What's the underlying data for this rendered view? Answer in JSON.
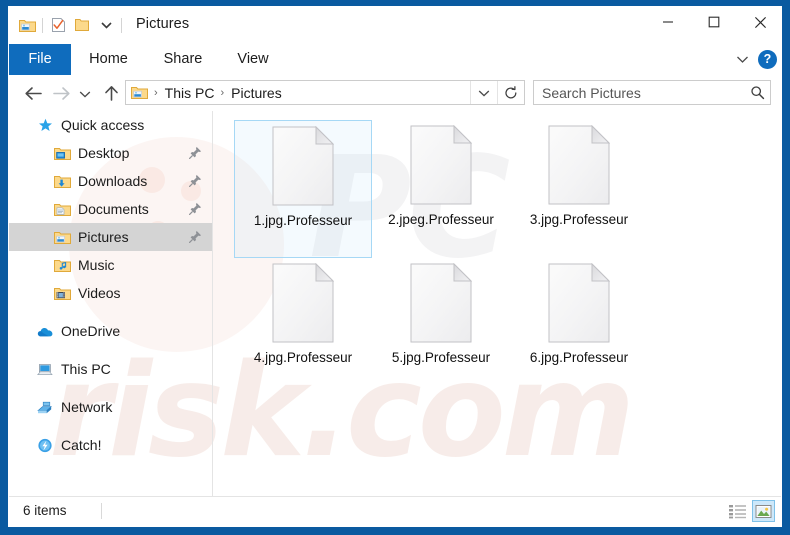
{
  "window": {
    "title": "Pictures",
    "quick_access_toolbar": [
      {
        "name": "properties-icon",
        "label": "Properties"
      },
      {
        "name": "checkbox-icon",
        "label": "Select"
      },
      {
        "name": "new-folder-icon",
        "label": "New folder"
      },
      {
        "name": "chevron-down-icon",
        "label": "Customize Quick Access Toolbar"
      }
    ],
    "caption_buttons": [
      {
        "name": "minimize-button",
        "glyph": "─",
        "label": "Minimize"
      },
      {
        "name": "maximize-button",
        "glyph": "☐",
        "label": "Maximize"
      },
      {
        "name": "close-button",
        "glyph": "✕",
        "label": "Close"
      }
    ]
  },
  "ribbon": {
    "tabs": [
      {
        "label": "File",
        "selected": true
      },
      {
        "label": "Home",
        "selected": false
      },
      {
        "label": "Share",
        "selected": false
      },
      {
        "label": "View",
        "selected": false
      }
    ],
    "collapse_icon": "chevron-down-icon",
    "help_label": "?"
  },
  "navigation": {
    "back_label": "Back",
    "forward_label": "Forward",
    "recent_label": "Recent locations",
    "up_label": "Up",
    "breadcrumb": {
      "icon": "pictures-folder-icon",
      "crumbs": [
        "This PC",
        "Pictures"
      ],
      "separator": "›"
    },
    "dropdown_icon": "chevron-down-icon",
    "refresh_icon": "refresh-icon"
  },
  "search": {
    "placeholder": "Search Pictures",
    "value": "",
    "icon": "search-icon"
  },
  "sidebar": {
    "groups": [
      {
        "items": [
          {
            "label": "Quick access",
            "icon": "star-icon",
            "level": "root",
            "pinned": false,
            "selected": false
          },
          {
            "label": "Desktop",
            "icon": "desktop-folder-icon",
            "level": "child",
            "pinned": true,
            "selected": false
          },
          {
            "label": "Downloads",
            "icon": "downloads-folder-icon",
            "level": "child",
            "pinned": true,
            "selected": false
          },
          {
            "label": "Documents",
            "icon": "documents-folder-icon",
            "level": "child",
            "pinned": true,
            "selected": false
          },
          {
            "label": "Pictures",
            "icon": "pictures-folder-icon",
            "level": "child",
            "pinned": true,
            "selected": true
          },
          {
            "label": "Music",
            "icon": "music-folder-icon",
            "level": "child",
            "pinned": false,
            "selected": false
          },
          {
            "label": "Videos",
            "icon": "videos-folder-icon",
            "level": "child",
            "pinned": false,
            "selected": false
          }
        ]
      },
      {
        "items": [
          {
            "label": "OneDrive",
            "icon": "onedrive-cloud-icon",
            "level": "root",
            "pinned": false,
            "selected": false
          }
        ]
      },
      {
        "items": [
          {
            "label": "This PC",
            "icon": "this-pc-icon",
            "level": "root",
            "pinned": false,
            "selected": false
          }
        ]
      },
      {
        "items": [
          {
            "label": "Network",
            "icon": "network-icon",
            "level": "root",
            "pinned": false,
            "selected": false
          }
        ]
      },
      {
        "items": [
          {
            "label": "Catch!",
            "icon": "catch-app-icon",
            "level": "root",
            "pinned": false,
            "selected": false
          }
        ]
      }
    ]
  },
  "files": [
    {
      "name": "1.jpg.Professeur",
      "icon": "blank-file-icon",
      "selected": true
    },
    {
      "name": "2.jpeg.Professeur",
      "icon": "blank-file-icon",
      "selected": false
    },
    {
      "name": "3.jpg.Professeur",
      "icon": "blank-file-icon",
      "selected": false
    },
    {
      "name": "4.jpg.Professeur",
      "icon": "blank-file-icon",
      "selected": false
    },
    {
      "name": "5.jpg.Professeur",
      "icon": "blank-file-icon",
      "selected": false
    },
    {
      "name": "6.jpg.Professeur",
      "icon": "blank-file-icon",
      "selected": false
    }
  ],
  "status": {
    "item_count": "6 items",
    "view_buttons": [
      {
        "name": "details-view-button",
        "label": "Details view",
        "active": false
      },
      {
        "name": "large-icons-view-button",
        "label": "Large icons view",
        "active": true
      }
    ]
  },
  "watermark": {
    "main": "risk.com",
    "top": "PC"
  },
  "colors": {
    "frame_blue": "#0a5aa0",
    "accent_blue": "#0f6cbd",
    "selection_blue": "#cde8fa",
    "nav_selected_gray": "#d4d4d4"
  }
}
